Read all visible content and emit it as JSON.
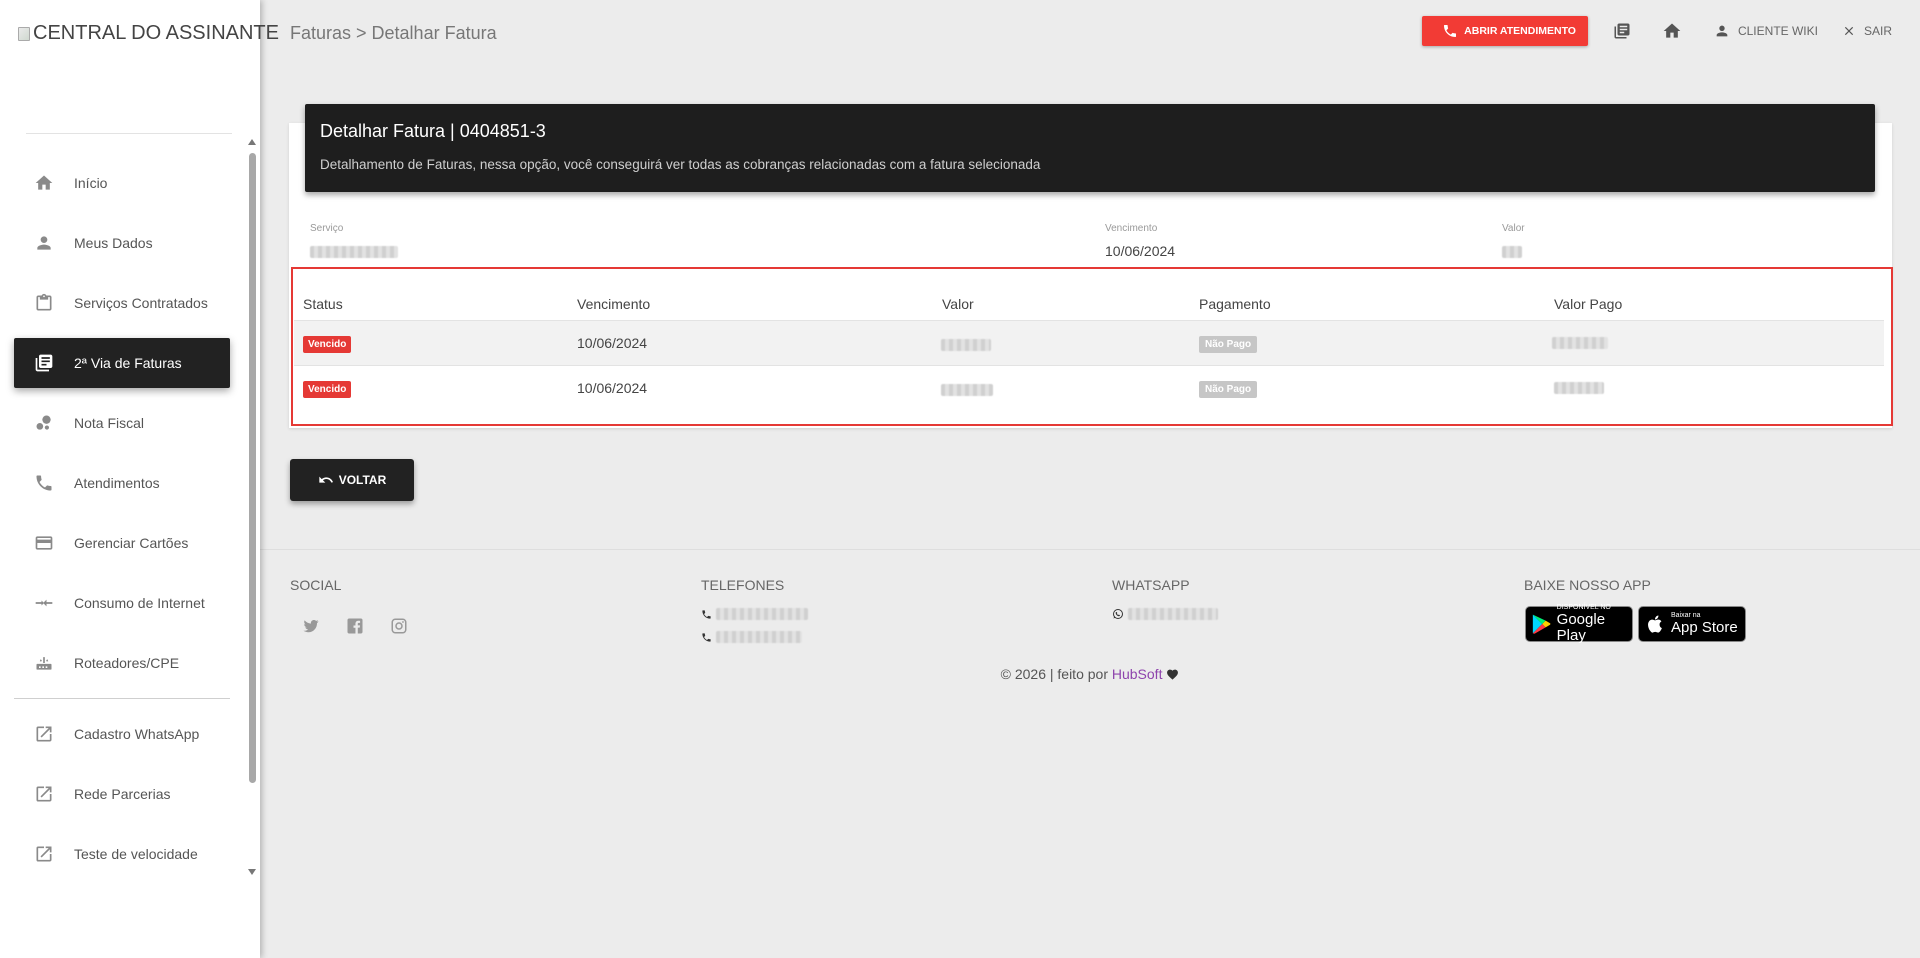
{
  "brand": {
    "alt_text": "CENTRAL DO ASSINANTE"
  },
  "sidebar": {
    "items": [
      {
        "label": "Início",
        "icon": "home-icon"
      },
      {
        "label": "Meus Dados",
        "icon": "person-icon"
      },
      {
        "label": "Serviços Contratados",
        "icon": "clipboard-icon"
      },
      {
        "label": "2ª Via de Faturas",
        "icon": "invoices-icon",
        "active": true
      },
      {
        "label": "Nota Fiscal",
        "icon": "bubbles-icon"
      },
      {
        "label": "Atendimentos",
        "icon": "phone-icon"
      },
      {
        "label": "Gerenciar Cartões",
        "icon": "credit-card-icon"
      },
      {
        "label": "Consumo de Internet",
        "icon": "transfer-icon"
      },
      {
        "label": "Roteadores/CPE",
        "icon": "router-icon"
      }
    ],
    "external_items": [
      {
        "label": "Cadastro WhatsApp",
        "icon": "external-link-icon"
      },
      {
        "label": "Rede Parcerias",
        "icon": "external-link-icon"
      },
      {
        "label": "Teste de velocidade",
        "icon": "external-link-icon"
      }
    ]
  },
  "header": {
    "breadcrumb": "Faturas > Detalhar Fatura",
    "atendimento_label": "ABRIR ATENDIMENTO",
    "wiki_label": "CLIENTE WIKI",
    "logout_label": "SAIR"
  },
  "card": {
    "title": "Detalhar Fatura | 0404851-3",
    "subtitle": "Detalhamento de Faturas, nessa opção, você conseguirá ver todas as cobranças relacionadas com a fatura selecionada"
  },
  "invoice_info": {
    "servico_label": "Serviço",
    "vencimento_label": "Vencimento",
    "vencimento_value": "10/06/2024",
    "valor_label": "Valor"
  },
  "table": {
    "headers": [
      "Status",
      "Vencimento",
      "Valor",
      "Pagamento",
      "Valor Pago"
    ],
    "rows": [
      {
        "status": "Vencido",
        "vencimento": "10/06/2024",
        "pagamento": "Não Pago"
      },
      {
        "status": "Vencido",
        "vencimento": "10/06/2024",
        "pagamento": "Não Pago"
      }
    ]
  },
  "back_button": "VOLTAR",
  "footer": {
    "social_title": "SOCIAL",
    "phones_title": "TELEFONES",
    "whatsapp_title": "WHATSAPP",
    "app_title": "BAIXE NOSSO APP",
    "google_play_small": "DISPONÍVEL NO",
    "google_play_big": "Google Play",
    "app_store_small": "Baixar na",
    "app_store_big": "App Store",
    "copyright_prefix": "© 2026 | feito por",
    "copyright_link": "HubSoft",
    "colors": {
      "link": "#8e44ad",
      "heart": "#333333"
    }
  },
  "colors": {
    "accent_red": "#f23b35",
    "dark": "#1e1e1e",
    "badge_red": "#e53935",
    "badge_gray": "#c6c6c6"
  }
}
